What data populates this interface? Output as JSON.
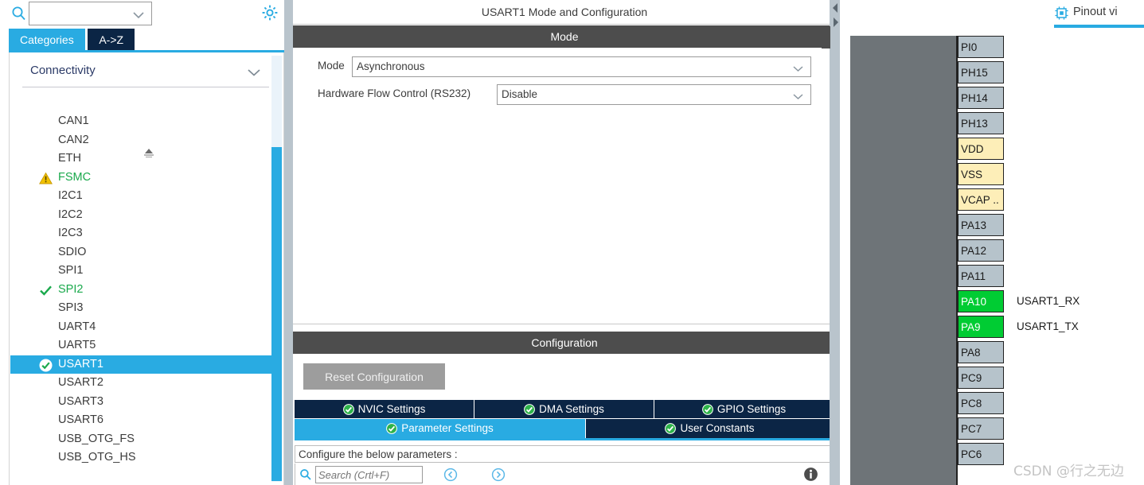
{
  "sidebar": {
    "search": {
      "value": "",
      "placeholder": "",
      "icon": "search-icon"
    },
    "gear": {
      "icon": "gear-icon"
    },
    "tabs": [
      {
        "label": "Categories",
        "active": true
      },
      {
        "label": "A->Z",
        "active": false
      }
    ],
    "group": {
      "label": "Connectivity",
      "chevron": "chevron-down-icon"
    },
    "peripherals": [
      {
        "label": "CAN1",
        "state": "none"
      },
      {
        "label": "CAN2",
        "state": "none"
      },
      {
        "label": "ETH",
        "state": "none"
      },
      {
        "label": "FSMC",
        "state": "warning"
      },
      {
        "label": "I2C1",
        "state": "none"
      },
      {
        "label": "I2C2",
        "state": "none"
      },
      {
        "label": "I2C3",
        "state": "none"
      },
      {
        "label": "SDIO",
        "state": "none"
      },
      {
        "label": "SPI1",
        "state": "none"
      },
      {
        "label": "SPI2",
        "state": "check"
      },
      {
        "label": "SPI3",
        "state": "none"
      },
      {
        "label": "UART4",
        "state": "none"
      },
      {
        "label": "UART5",
        "state": "none"
      },
      {
        "label": "USART1",
        "state": "check-selected"
      },
      {
        "label": "USART2",
        "state": "none"
      },
      {
        "label": "USART3",
        "state": "none"
      },
      {
        "label": "USART6",
        "state": "none"
      },
      {
        "label": "USB_OTG_FS",
        "state": "none"
      },
      {
        "label": "USB_OTG_HS",
        "state": "none"
      }
    ]
  },
  "center": {
    "title": "USART1 Mode and Configuration",
    "mode_header": "Mode",
    "fields": [
      {
        "label": "Mode",
        "value": "Asynchronous"
      },
      {
        "label": "Hardware Flow Control (RS232)",
        "value": "Disable"
      }
    ],
    "configuration_header": "Configuration",
    "reset_button": "Reset Configuration",
    "tabs_row1": [
      {
        "label": "NVIC Settings",
        "active": false
      },
      {
        "label": "DMA Settings",
        "active": false
      },
      {
        "label": "GPIO Settings",
        "active": false
      }
    ],
    "tabs_row2": [
      {
        "label": "Parameter Settings",
        "active": true
      },
      {
        "label": "User Constants",
        "active": false
      }
    ],
    "configure_note": "Configure the below parameters :",
    "param_search_placeholder": "Search (Crtl+F)",
    "nav_prev_icon": "circle-left-arrow-icon",
    "nav_next_icon": "circle-right-arrow-icon",
    "info_icon": "info-icon"
  },
  "rightpane": {
    "view_tab": {
      "label": "Pinout vi",
      "icon": "chip-icon"
    },
    "pins": [
      {
        "name": "PI0",
        "kind": "io",
        "signal": ""
      },
      {
        "name": "PH15",
        "kind": "io",
        "signal": ""
      },
      {
        "name": "PH14",
        "kind": "io",
        "signal": ""
      },
      {
        "name": "PH13",
        "kind": "io",
        "signal": ""
      },
      {
        "name": "VDD",
        "kind": "pwr",
        "signal": ""
      },
      {
        "name": "VSS",
        "kind": "pwr",
        "signal": ""
      },
      {
        "name": "VCAP ..",
        "kind": "pwr",
        "signal": ""
      },
      {
        "name": "PA13",
        "kind": "io",
        "signal": ""
      },
      {
        "name": "PA12",
        "kind": "io",
        "signal": ""
      },
      {
        "name": "PA11",
        "kind": "io",
        "signal": ""
      },
      {
        "name": "PA10",
        "kind": "used",
        "signal": "USART1_RX"
      },
      {
        "name": "PA9",
        "kind": "used",
        "signal": "USART1_TX"
      },
      {
        "name": "PA8",
        "kind": "io",
        "signal": ""
      },
      {
        "name": "PC9",
        "kind": "io",
        "signal": ""
      },
      {
        "name": "PC8",
        "kind": "io",
        "signal": ""
      },
      {
        "name": "PC7",
        "kind": "io",
        "signal": ""
      },
      {
        "name": "PC6",
        "kind": "io",
        "signal": ""
      }
    ]
  },
  "watermark": "CSDN @行之无边",
  "colors": {
    "accent_blue": "#29abe2",
    "navy": "#0b2545",
    "header_gray": "#4d4d4d",
    "pin_io": "#b6c3cb",
    "pin_power": "#fdeeb8",
    "pin_used": "#00cc33",
    "ok_green": "#1aa94c",
    "warning_yellow": "#f2c200"
  }
}
